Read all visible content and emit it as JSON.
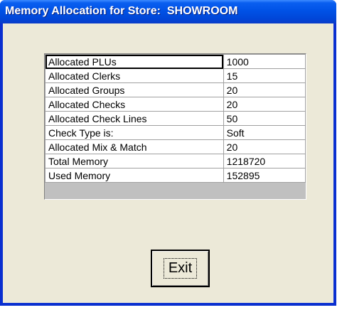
{
  "window": {
    "title": "Memory Allocation for Store:  SHOWROOM"
  },
  "grid": {
    "rows": [
      {
        "label": "Allocated PLUs",
        "value": "1000"
      },
      {
        "label": "Allocated Clerks",
        "value": "15"
      },
      {
        "label": "Allocated Groups",
        "value": "20"
      },
      {
        "label": "Allocated Checks",
        "value": "20"
      },
      {
        "label": "Allocated Check Lines",
        "value": "50"
      },
      {
        "label": "Check Type is:",
        "value": "Soft"
      },
      {
        "label": "Allocated Mix & Match",
        "value": "20"
      },
      {
        "label": "Total Memory",
        "value": "1218720"
      },
      {
        "label": "Used Memory",
        "value": "152895"
      }
    ]
  },
  "buttons": {
    "exit_label": "Exit"
  },
  "colors": {
    "titlebar": "#0054e3",
    "client_background": "#ece9d8",
    "grid_empty": "#c0c0c0"
  }
}
